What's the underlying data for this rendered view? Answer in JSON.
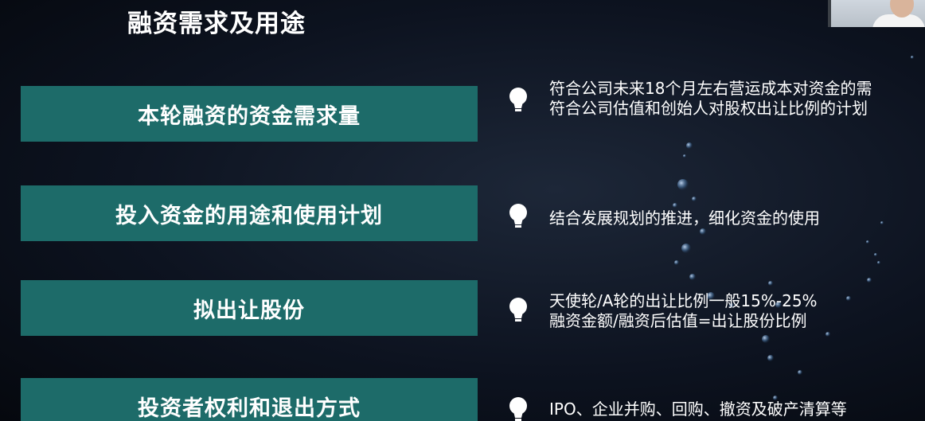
{
  "title": "融资需求及用途",
  "rows": [
    {
      "label": "本轮融资的资金需求量",
      "details": [
        "符合公司未来18个月左右营运成本对资金的需",
        "符合公司估值和创始人对股权出让比例的计划"
      ]
    },
    {
      "label": "投入资金的用途和使用计划",
      "details": [
        "结合发展规划的推进，细化资金的使用"
      ]
    },
    {
      "label": "拟出让股份",
      "details": [
        "天使轮/A轮的出让比例一般15%-25%",
        "融资金额/融资后估值=出让股份比例"
      ]
    },
    {
      "label": "投资者权利和退出方式",
      "details": [
        "IPO、企业并购、回购、撤资及破产清算等"
      ]
    }
  ],
  "icons": {
    "bullet": "lightbulb-icon",
    "decoration": "bubble-stream"
  },
  "colors": {
    "box": "#1d6b69",
    "text": "#ffffff",
    "background": "#0d1320"
  }
}
